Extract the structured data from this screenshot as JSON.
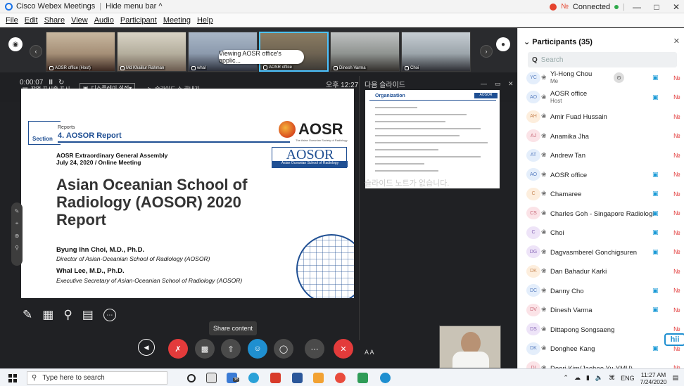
{
  "titlebar": {
    "app_title": "Cisco Webex Meetings",
    "hide_menu": "Hide menu bar ^",
    "status": "Connected",
    "minimize": "—",
    "restore": "□",
    "close": "✕"
  },
  "menu": [
    "File",
    "Edit",
    "Share",
    "View",
    "Audio",
    "Participant",
    "Meeting",
    "Help"
  ],
  "filmstrip": [
    {
      "name": "AOSR office (Host)"
    },
    {
      "name": "Md Khalilur Rahman"
    },
    {
      "name": "whal"
    },
    {
      "name": "AOSR office"
    },
    {
      "name": "Dinesh Varma"
    },
    {
      "name": "Choi"
    }
  ],
  "sharebar": {
    "item1": "작업 표시줄 표시",
    "item2": "디스플레이 설정▾",
    "item3": "슬라이드 쇼 끝내기",
    "viewing": "Viewing AOSR office's applic..."
  },
  "presenter": {
    "elapsed": "0:00:07",
    "clock": "오후 12:27",
    "next_label": "다음 슬라이드",
    "notes": "슬라이드 노트가 없습니다."
  },
  "slide": {
    "section": "Section",
    "reports": "Reports",
    "report_title": "4. AOSOR Report",
    "logo_text": "AOSR",
    "logo_sub": "The Asian Oceanian Society of Radiology",
    "aosor_text": "AOSOR",
    "aosor_sub": "Asian Oceanian School of Radiology",
    "meeting_line1": "AOSR Extraordinary General Assembly",
    "meeting_line2": "July 24, 2020 / Online Meeting",
    "big_title": "Asian Oceanian School of Radiology (AOSOR) 2020 Report",
    "author1": "Byung Ihn Choi, M.D., Ph.D.",
    "author1_role": "Director of Asian-Oceanian School of Radiology (AOSOR)",
    "author2": "Whal Lee, M.D., Ph.D.",
    "author2_role": "Executive Secretary of Asian-Oceanian School of Radiology (AOSOR)"
  },
  "next_slide": {
    "title": "Organization",
    "badge": "AOSOR"
  },
  "controls": {
    "tooltip": "Share content",
    "font_controls": "A  A"
  },
  "panel": {
    "title": "Participants (35)",
    "search_placeholder": "Search",
    "participants": [
      {
        "initials": "YC",
        "name": "Yi-Hong Chou",
        "sub": "Me",
        "cam": true,
        "color": "blue"
      },
      {
        "initials": "AO",
        "name": "AOSR office",
        "sub": "Host",
        "cam": true,
        "color": "blue"
      },
      {
        "initials": "AH",
        "name": "Amir Fuad Hussain",
        "sub": "",
        "cam": false,
        "color": "orange"
      },
      {
        "initials": "AJ",
        "name": "Anamika Jha",
        "sub": "",
        "cam": false,
        "color": "pink"
      },
      {
        "initials": "AT",
        "name": "Andrew Tan",
        "sub": "",
        "cam": false,
        "color": "blue"
      },
      {
        "initials": "AO",
        "name": "AOSR office",
        "sub": "",
        "cam": true,
        "color": "blue"
      },
      {
        "initials": "C",
        "name": "Chamaree",
        "sub": "",
        "cam": true,
        "color": "orange"
      },
      {
        "initials": "CS",
        "name": "Charles Goh - Singapore Radiological S...",
        "sub": "",
        "cam": true,
        "color": "pink"
      },
      {
        "initials": "C",
        "name": "Choi",
        "sub": "",
        "cam": true,
        "color": "purple"
      },
      {
        "initials": "DG",
        "name": "Dagvasmberel Gonchigsuren",
        "sub": "",
        "cam": true,
        "color": "purple"
      },
      {
        "initials": "DK",
        "name": "Dan Bahadur Karki",
        "sub": "",
        "cam": false,
        "color": "orange"
      },
      {
        "initials": "DC",
        "name": "Danny Cho",
        "sub": "",
        "cam": true,
        "color": "blue"
      },
      {
        "initials": "DV",
        "name": "Dinesh Varma",
        "sub": "",
        "cam": true,
        "color": "pink"
      },
      {
        "initials": "DS",
        "name": "Dittapong Songsaeng",
        "sub": "",
        "cam": false,
        "color": "purple"
      },
      {
        "initials": "DK",
        "name": "Donghee Kang",
        "sub": "",
        "cam": true,
        "color": "blue"
      },
      {
        "initials": "DI",
        "name": "Doori Kim(Jaeheo Yu-YMU)",
        "sub": "",
        "cam": false,
        "color": "pink"
      }
    ],
    "sticker": "hii"
  },
  "taskbar": {
    "search": "Type here to search",
    "lang": "ENG",
    "time": "11:27 AM",
    "date": "7/24/2020",
    "badge": "36"
  }
}
